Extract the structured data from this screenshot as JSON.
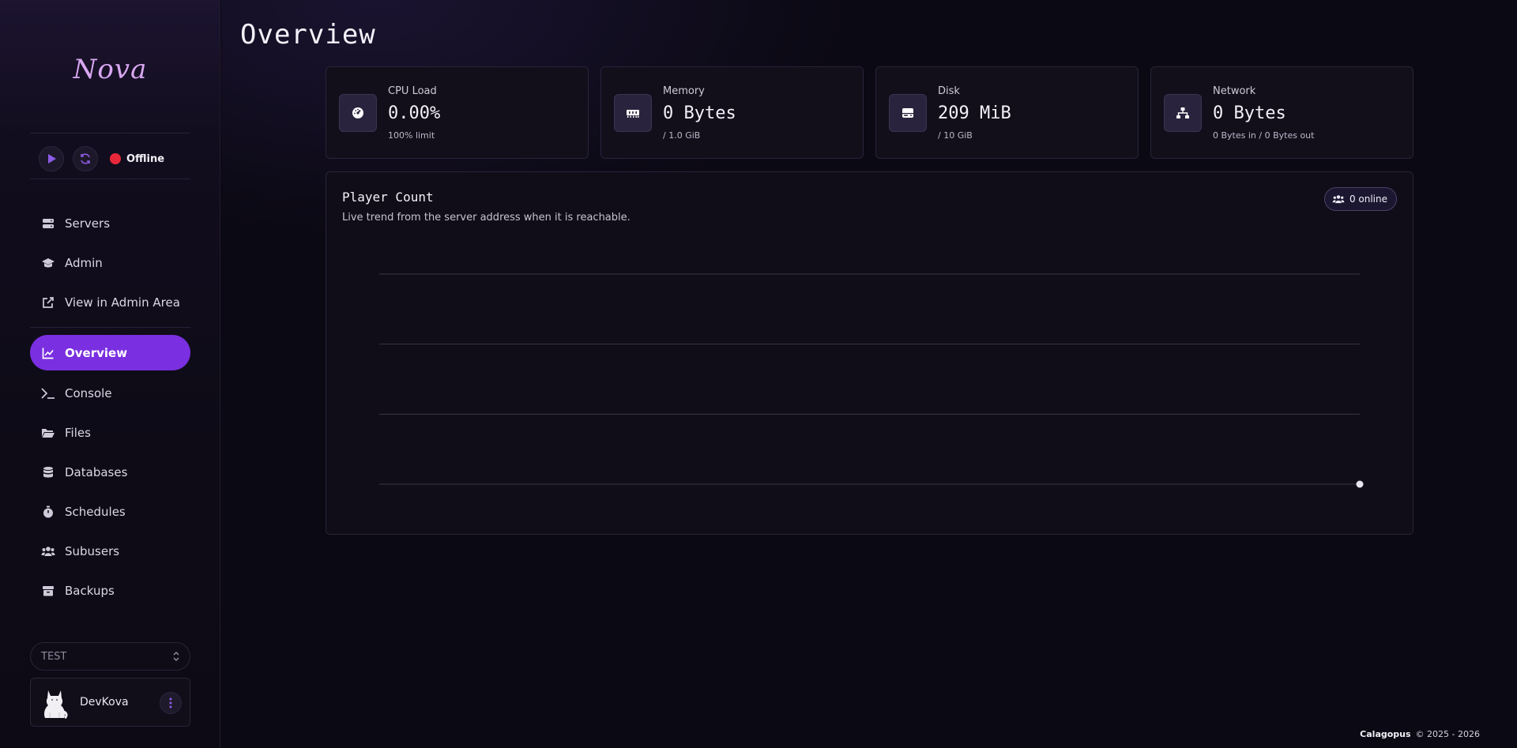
{
  "sidebar": {
    "logo": "Nova",
    "status": {
      "label": "Offline",
      "color": "#e8283a"
    },
    "nav_top": [
      {
        "label": "Servers",
        "icon": "server-icon"
      },
      {
        "label": "Admin",
        "icon": "graduation-cap-icon"
      },
      {
        "label": "View in Admin Area",
        "icon": "external-link-icon"
      }
    ],
    "nav_main": [
      {
        "label": "Overview",
        "icon": "chart-line-icon",
        "active": true
      },
      {
        "label": "Console",
        "icon": "terminal-icon"
      },
      {
        "label": "Files",
        "icon": "folder-open-icon"
      },
      {
        "label": "Databases",
        "icon": "database-icon"
      },
      {
        "label": "Schedules",
        "icon": "stopwatch-icon"
      },
      {
        "label": "Subusers",
        "icon": "users-icon"
      },
      {
        "label": "Backups",
        "icon": "archive-icon"
      }
    ],
    "server_select": {
      "value": "TEST"
    },
    "user": {
      "name": "DevKova"
    }
  },
  "main": {
    "title": "Overview",
    "stats": [
      {
        "label": "CPU Load",
        "value": "0.00%",
        "sub": "100% limit",
        "icon": "gauge-icon"
      },
      {
        "label": "Memory",
        "value": "0 Bytes",
        "sub": "/ 1.0 GiB",
        "icon": "memory-icon"
      },
      {
        "label": "Disk",
        "value": "209 MiB",
        "sub": "/ 10 GiB",
        "icon": "hard-drive-icon"
      },
      {
        "label": "Network",
        "value": "0 Bytes",
        "sub": "0 Bytes in / 0 Bytes out",
        "icon": "network-icon"
      }
    ],
    "player_count": {
      "title": "Player Count",
      "subtitle": "Live trend from the server address when it is reachable.",
      "badge": "0 online"
    }
  },
  "chart_data": {
    "type": "line",
    "title": "Player Count",
    "x": [
      0
    ],
    "series": [
      {
        "values": [
          0
        ]
      }
    ],
    "ylim": [
      0,
      3
    ],
    "grid": true,
    "line_color": "#e8e5f0",
    "grid_color": "#3a3548"
  },
  "footer": {
    "brand": "Calagopus",
    "copyright": "© 2025 - 2026"
  },
  "colors": {
    "accent": "#7a2fe0",
    "offline": "#e8283a",
    "background": "#0b0913"
  }
}
